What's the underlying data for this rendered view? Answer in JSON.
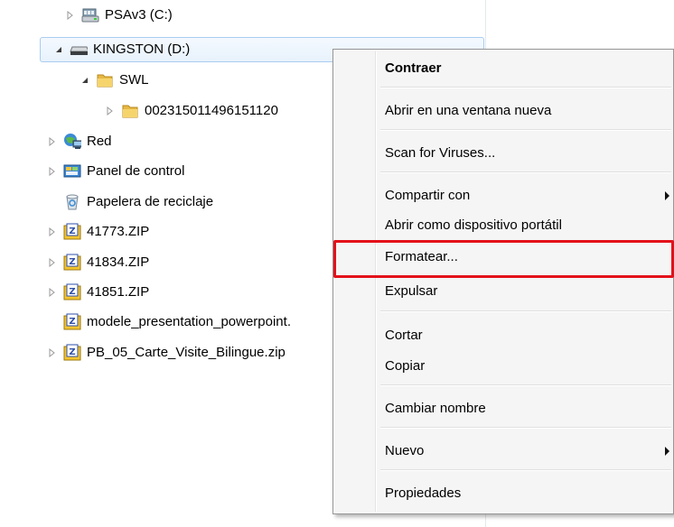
{
  "tree": {
    "items": [
      {
        "label": "PSAv3 (C:)",
        "icon": "hard-drive-icon"
      },
      {
        "label": "KINGSTON (D:)",
        "icon": "usb-drive-icon"
      },
      {
        "label": "SWL",
        "icon": "folder-icon"
      },
      {
        "label": "002315011496151120",
        "icon": "folder-icon"
      },
      {
        "label": "Red",
        "icon": "network-icon"
      },
      {
        "label": "Panel de control",
        "icon": "control-panel-icon"
      },
      {
        "label": "Papelera de reciclaje",
        "icon": "recycle-bin-icon"
      },
      {
        "label": "41773.ZIP",
        "icon": "zip-archive-icon"
      },
      {
        "label": "41834.ZIP",
        "icon": "zip-archive-icon"
      },
      {
        "label": "41851.ZIP",
        "icon": "zip-archive-icon"
      },
      {
        "label": "modele_presentation_powerpoint.",
        "icon": "zip-archive-icon"
      },
      {
        "label": "PB_05_Carte_Visite_Bilingue.zip",
        "icon": "zip-archive-icon"
      }
    ]
  },
  "context_menu": {
    "items": [
      {
        "label": "Contraer"
      },
      {
        "label": "Abrir en una ventana nueva"
      },
      {
        "label": "Scan for Viruses..."
      },
      {
        "label": "Compartir con"
      },
      {
        "label": "Abrir como dispositivo portátil"
      },
      {
        "label": "Formatear..."
      },
      {
        "label": "Expulsar"
      },
      {
        "label": "Cortar"
      },
      {
        "label": "Copiar"
      },
      {
        "label": "Cambiar nombre"
      },
      {
        "label": "Nuevo"
      },
      {
        "label": "Propiedades"
      }
    ]
  },
  "colors": {
    "highlight_outline": "#e3101a",
    "selection_border": "#a9cdf0",
    "menu_background": "#f5f5f5"
  }
}
